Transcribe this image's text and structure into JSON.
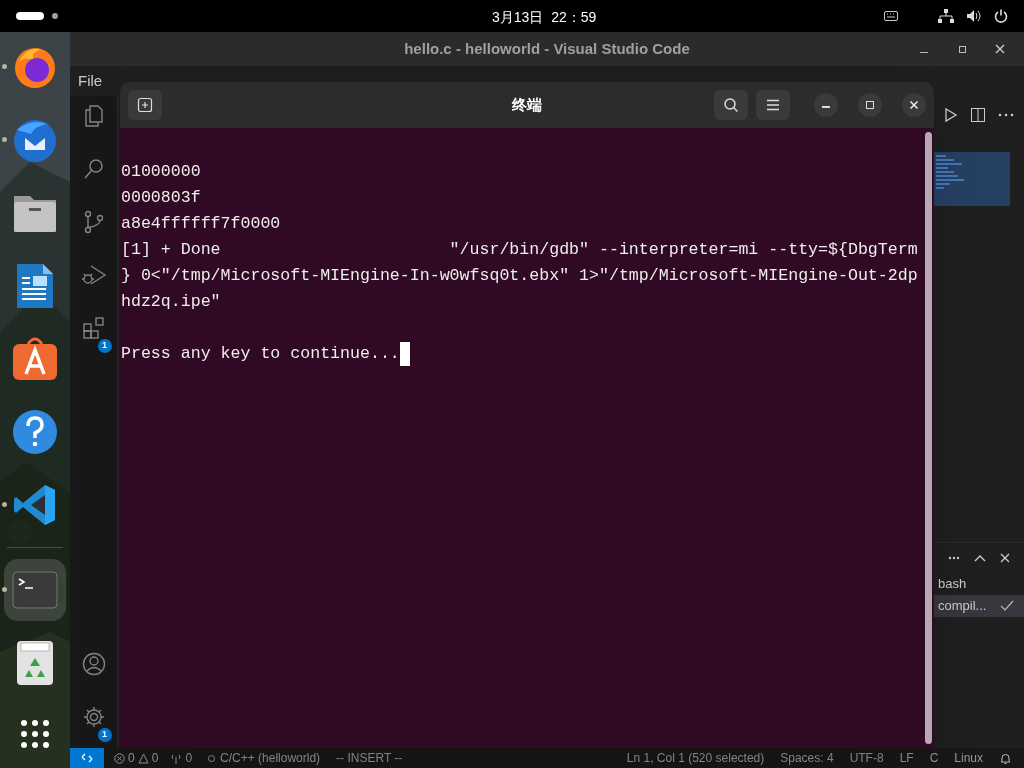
{
  "top_bar": {
    "clock": "3月13日  22：59"
  },
  "dock": [
    {
      "kind": "browser",
      "running": true,
      "selected": false
    },
    {
      "kind": "mail",
      "running": true,
      "selected": false
    },
    {
      "kind": "folder",
      "running": false,
      "selected": false
    },
    {
      "kind": "document",
      "running": false,
      "selected": false
    },
    {
      "kind": "store",
      "running": false,
      "selected": false
    },
    {
      "kind": "help",
      "running": false,
      "selected": false
    },
    {
      "kind": "code",
      "running": true,
      "selected": false
    },
    {
      "kind": "terminal",
      "running": true,
      "selected": true
    },
    {
      "kind": "trash",
      "running": false,
      "selected": false
    }
  ],
  "vscode": {
    "title": "hello.c - helloworld - Visual Studio Code",
    "menu": [
      "File"
    ],
    "activity_bar": [
      {
        "kind": "files"
      },
      {
        "kind": "search"
      },
      {
        "kind": "source-control"
      },
      {
        "kind": "debug"
      },
      {
        "kind": "extensions",
        "badge": "1"
      }
    ],
    "activity_bar_bottom": [
      {
        "kind": "account"
      },
      {
        "kind": "settings",
        "badge": "1"
      }
    ],
    "terminal_list": [
      {
        "label": "bash",
        "selected": false
      },
      {
        "label": "compil...",
        "selected": true
      }
    ],
    "status_bar": {
      "errors": "0",
      "warnings": "0",
      "ports": "0",
      "project": "C/C++ (helloworld)",
      "mode": "-- INSERT --",
      "right": [
        "Ln 1, Col 1 (520 selected)",
        "Spaces: 4",
        "UTF-8",
        "LF",
        "C",
        "Linux"
      ]
    }
  },
  "terminal": {
    "title": "终端",
    "lines": [
      "01000000",
      "0000803f",
      "a8e4ffffff7f0000",
      "[1] + Done                       \"/usr/bin/gdb\" --interpreter=mi --tty=${DbgTerm",
      "} 0<\"/tmp/Microsoft-MIEngine-In-w0wfsq0t.ebx\" 1>\"/tmp/Microsoft-MIEngine-Out-2dp",
      "hdz2q.ipe\""
    ],
    "prompt": "Press any key to continue..."
  }
}
